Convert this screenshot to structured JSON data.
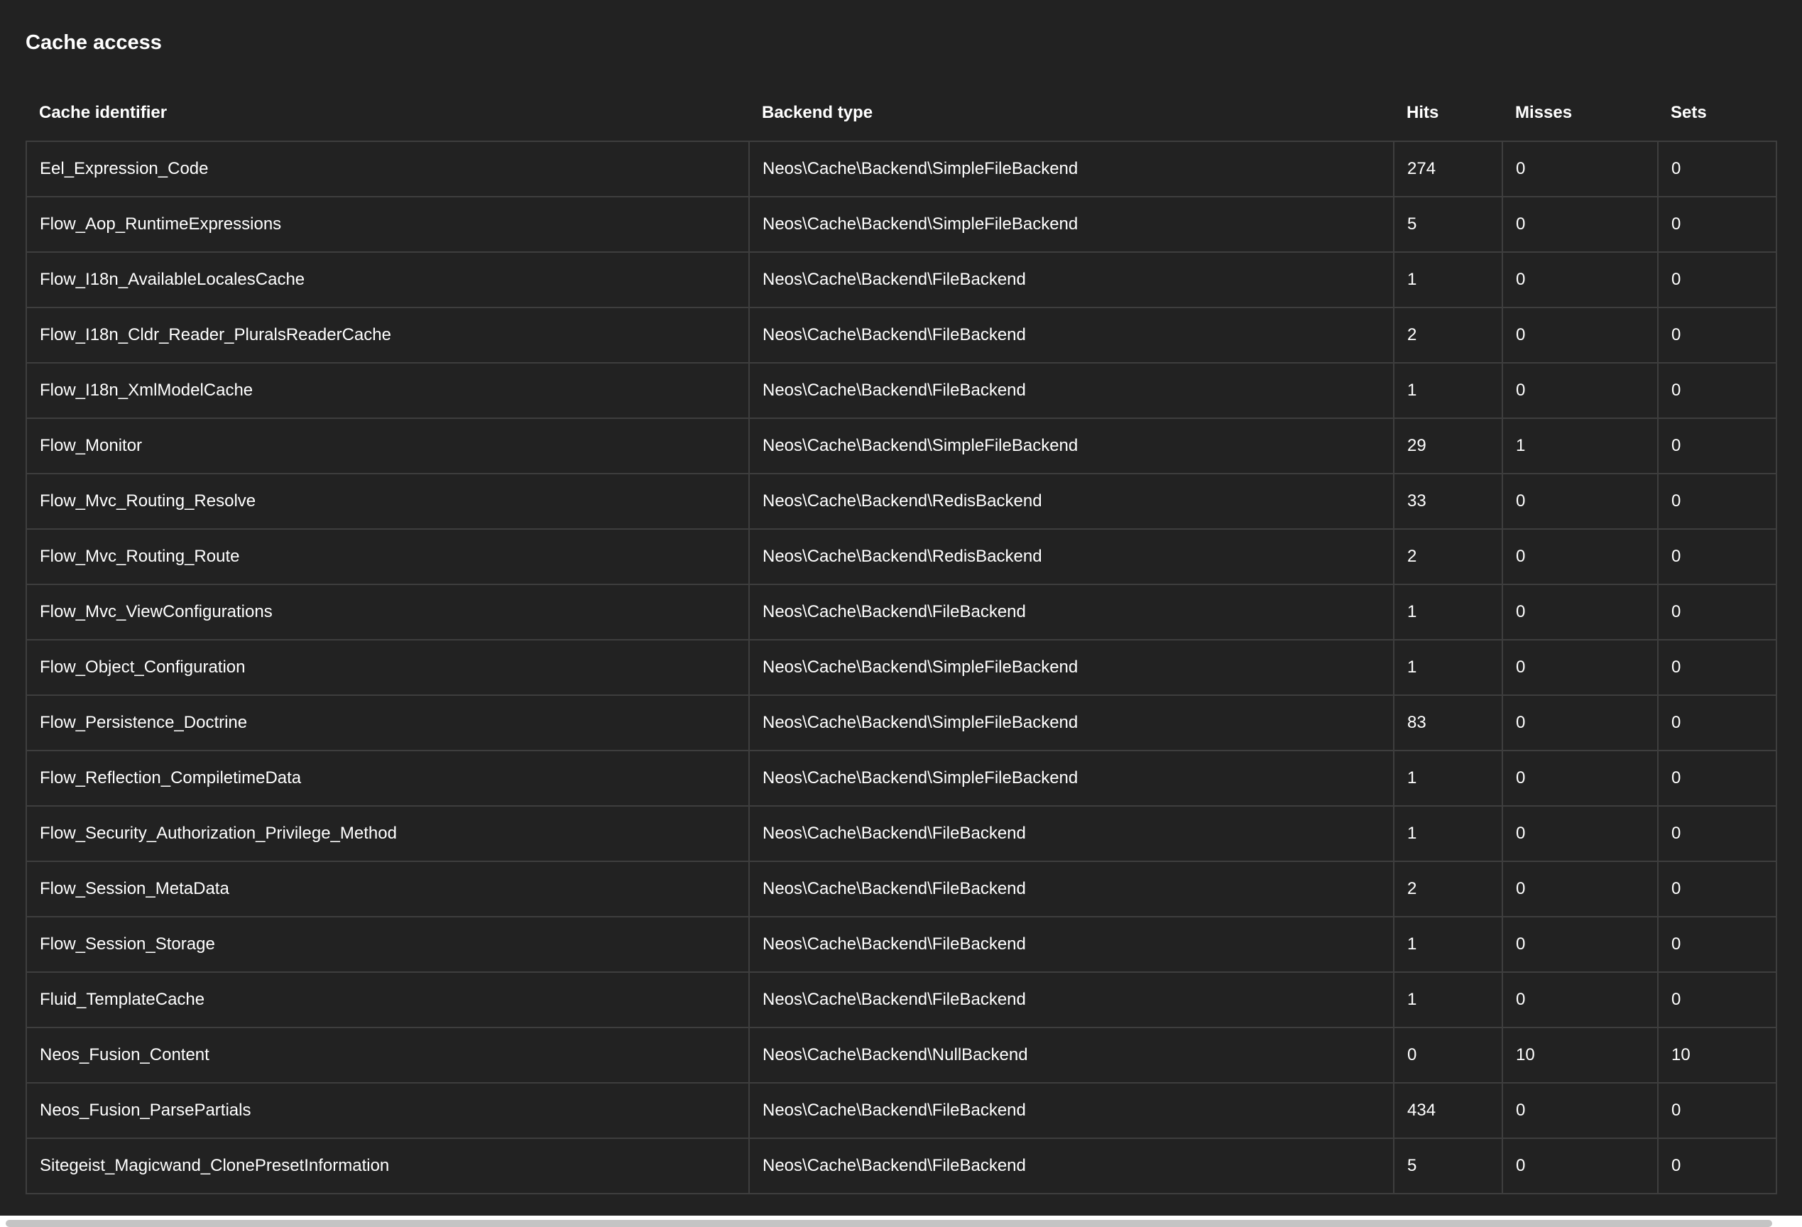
{
  "title": "Cache access",
  "columns": [
    "Cache identifier",
    "Backend type",
    "Hits",
    "Misses",
    "Sets"
  ],
  "rows": [
    [
      "Eel_Expression_Code",
      "Neos\\Cache\\Backend\\SimpleFileBackend",
      "274",
      "0",
      "0"
    ],
    [
      "Flow_Aop_RuntimeExpressions",
      "Neos\\Cache\\Backend\\SimpleFileBackend",
      "5",
      "0",
      "0"
    ],
    [
      "Flow_I18n_AvailableLocalesCache",
      "Neos\\Cache\\Backend\\FileBackend",
      "1",
      "0",
      "0"
    ],
    [
      "Flow_I18n_Cldr_Reader_PluralsReaderCache",
      "Neos\\Cache\\Backend\\FileBackend",
      "2",
      "0",
      "0"
    ],
    [
      "Flow_I18n_XmlModelCache",
      "Neos\\Cache\\Backend\\FileBackend",
      "1",
      "0",
      "0"
    ],
    [
      "Flow_Monitor",
      "Neos\\Cache\\Backend\\SimpleFileBackend",
      "29",
      "1",
      "0"
    ],
    [
      "Flow_Mvc_Routing_Resolve",
      "Neos\\Cache\\Backend\\RedisBackend",
      "33",
      "0",
      "0"
    ],
    [
      "Flow_Mvc_Routing_Route",
      "Neos\\Cache\\Backend\\RedisBackend",
      "2",
      "0",
      "0"
    ],
    [
      "Flow_Mvc_ViewConfigurations",
      "Neos\\Cache\\Backend\\FileBackend",
      "1",
      "0",
      "0"
    ],
    [
      "Flow_Object_Configuration",
      "Neos\\Cache\\Backend\\SimpleFileBackend",
      "1",
      "0",
      "0"
    ],
    [
      "Flow_Persistence_Doctrine",
      "Neos\\Cache\\Backend\\SimpleFileBackend",
      "83",
      "0",
      "0"
    ],
    [
      "Flow_Reflection_CompiletimeData",
      "Neos\\Cache\\Backend\\SimpleFileBackend",
      "1",
      "0",
      "0"
    ],
    [
      "Flow_Security_Authorization_Privilege_Method",
      "Neos\\Cache\\Backend\\FileBackend",
      "1",
      "0",
      "0"
    ],
    [
      "Flow_Session_MetaData",
      "Neos\\Cache\\Backend\\FileBackend",
      "2",
      "0",
      "0"
    ],
    [
      "Flow_Session_Storage",
      "Neos\\Cache\\Backend\\FileBackend",
      "1",
      "0",
      "0"
    ],
    [
      "Fluid_TemplateCache",
      "Neos\\Cache\\Backend\\FileBackend",
      "1",
      "0",
      "0"
    ],
    [
      "Neos_Fusion_Content",
      "Neos\\Cache\\Backend\\NullBackend",
      "0",
      "10",
      "10"
    ],
    [
      "Neos_Fusion_ParsePartials",
      "Neos\\Cache\\Backend\\FileBackend",
      "434",
      "0",
      "0"
    ],
    [
      "Sitegeist_Magicwand_ClonePresetInformation",
      "Neos\\Cache\\Backend\\FileBackend",
      "5",
      "0",
      "0"
    ]
  ]
}
